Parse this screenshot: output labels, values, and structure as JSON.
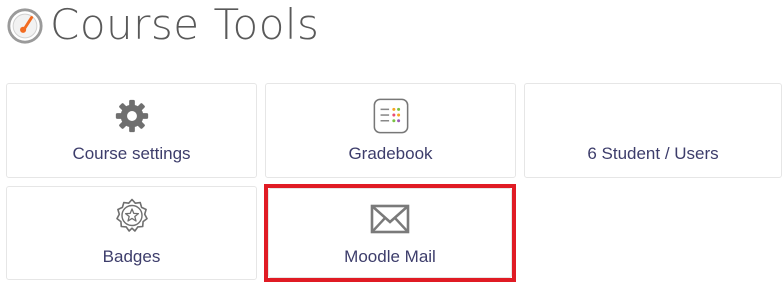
{
  "header": {
    "title": "Course Tools",
    "icon": "speedometer-icon"
  },
  "tiles": [
    {
      "label": "Course settings",
      "icon": "gear-icon"
    },
    {
      "label": "Gradebook",
      "icon": "gradebook-icon"
    },
    {
      "label": "6 Student / Users",
      "icon": ""
    },
    {
      "label": "Badges",
      "icon": "badge-icon"
    },
    {
      "label": "Moodle Mail",
      "icon": "mail-icon"
    }
  ],
  "colors": {
    "label": "#3d3d6b",
    "title": "#595959",
    "icon": "#707070",
    "highlight": "#e01b24",
    "accent": "#f26b21"
  }
}
